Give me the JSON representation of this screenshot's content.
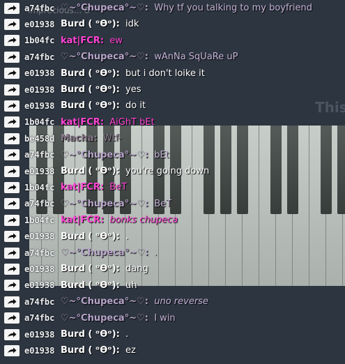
{
  "background_text": "This",
  "ghost_overlay": "imprecious... 8",
  "colors": {
    "burd": "#ffffff",
    "chupeca": "#b7a4c9",
    "kat": "#ff45d4",
    "macha": "#8a7a8c",
    "background": "#2d3540"
  },
  "messages": [
    {
      "uid": "a74fbc",
      "nick": "♡~°Chupeca°~♡",
      "sep": ":",
      "text": "Why tf you talking to my boyfriend",
      "style": "chupeca",
      "italic": false
    },
    {
      "uid": "e01938",
      "nick": "Burd ( ᵒƟᵒ)",
      "sep": ":",
      "text": "idk",
      "style": "burd",
      "italic": false
    },
    {
      "uid": "1b04fc",
      "nick": "kat|FCR",
      "sep": ":",
      "text": "ew",
      "style": "kat",
      "italic": false
    },
    {
      "uid": "a74fbc",
      "nick": "♡~°Chupeca°~♡",
      "sep": ":",
      "text": "wAnNa SqUaRe uP",
      "style": "chupeca",
      "italic": false
    },
    {
      "uid": "e01938",
      "nick": "Burd ( ᵒƟᵒ)",
      "sep": ":",
      "text": "but i don't loike it",
      "style": "burd",
      "italic": false
    },
    {
      "uid": "e01938",
      "nick": "Burd ( ᵒƟᵒ)",
      "sep": ":",
      "text": "yes",
      "style": "burd",
      "italic": false
    },
    {
      "uid": "e01938",
      "nick": "Burd ( ᵒƟᵒ)",
      "sep": ":",
      "text": "do it",
      "style": "burd",
      "italic": false
    },
    {
      "uid": "1b04fc",
      "nick": "kat|FCR",
      "sep": ":",
      "text": "AiGhT bEt",
      "style": "kat",
      "italic": false
    },
    {
      "uid": "be458d",
      "nick": "Macha",
      "sep": ":",
      "text": "Wtf-",
      "style": "macha",
      "italic": false
    },
    {
      "uid": "a74fbc",
      "nick": "♡~°Chupeca°~♡",
      "sep": ":",
      "text": "bEt",
      "style": "chupeca",
      "italic": false
    },
    {
      "uid": "e01938",
      "nick": "Burd ( ᵒƟᵒ)",
      "sep": ":",
      "text": "you're going down",
      "style": "burd",
      "italic": false
    },
    {
      "uid": "1b04fc",
      "nick": "kat|FCR",
      "sep": ":",
      "text": "BeT",
      "style": "kat",
      "italic": false
    },
    {
      "uid": "a74fbc",
      "nick": "♡~°Chupeca°~♡",
      "sep": ":",
      "text": "BeT",
      "style": "chupeca",
      "italic": false
    },
    {
      "uid": "1b04fc",
      "nick": "kat|FCR",
      "sep": ":",
      "text": "bonks chupeca",
      "style": "kat",
      "italic": true
    },
    {
      "uid": "e01938",
      "nick": "Burd ( ᵒƟᵒ)",
      "sep": ":",
      "text": ".",
      "style": "burd",
      "italic": false
    },
    {
      "uid": "a74fbc",
      "nick": "♡~°Chupeca°~♡",
      "sep": ":",
      "text": ".",
      "style": "chupeca",
      "italic": false
    },
    {
      "uid": "e01938",
      "nick": "Burd ( ᵒƟᵒ)",
      "sep": ":",
      "text": "dang",
      "style": "burd",
      "italic": false
    },
    {
      "uid": "e01938",
      "nick": "Burd ( ᵒƟᵒ)",
      "sep": ":",
      "text": "uh",
      "style": "burd",
      "italic": false
    },
    {
      "uid": "a74fbc",
      "nick": "♡~°Chupeca°~♡",
      "sep": ":",
      "text": "uno reverse",
      "style": "chupeca",
      "italic": true
    },
    {
      "uid": "a74fbc",
      "nick": "♡~°Chupeca°~♡",
      "sep": ":",
      "text": "I win",
      "style": "chupeca",
      "italic": false
    },
    {
      "uid": "e01938",
      "nick": "Burd ( ᵒƟᵒ)",
      "sep": ":",
      "text": ".",
      "style": "burd",
      "italic": false
    },
    {
      "uid": "e01938",
      "nick": "Burd ( ᵒƟᵒ)",
      "sep": ":",
      "text": "ez",
      "style": "burd",
      "italic": false
    }
  ]
}
